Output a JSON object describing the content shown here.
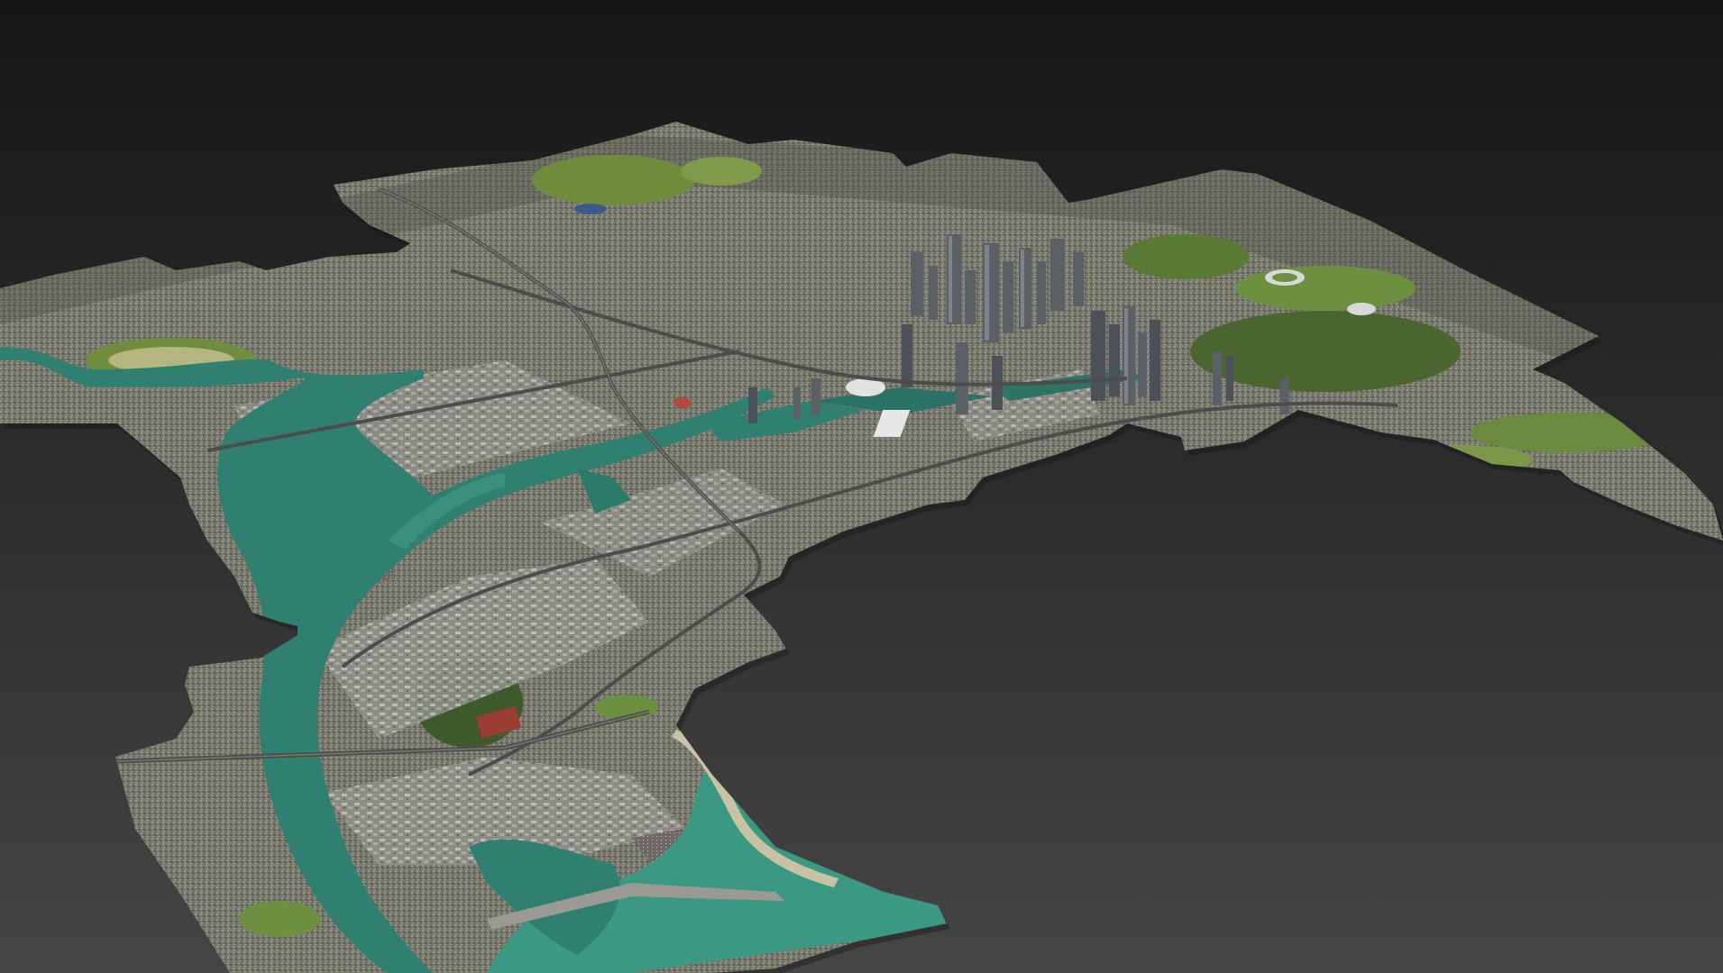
{
  "viewport": {
    "background_top": "#161616",
    "background_bottom": "#454545",
    "model": "photogrammetry-city-mesh"
  },
  "colors": {
    "urban": "#7a7a72",
    "urban_dark": "#55564f",
    "industrial": "#a3a39b",
    "water": "#2f8070",
    "water_bay": "#3b9883",
    "park": "#6b8a3c",
    "park_dark": "#3f5a2a",
    "roads": "#4c4c4c",
    "tower": "#5b6067",
    "stadium": "#d8d8d8"
  }
}
